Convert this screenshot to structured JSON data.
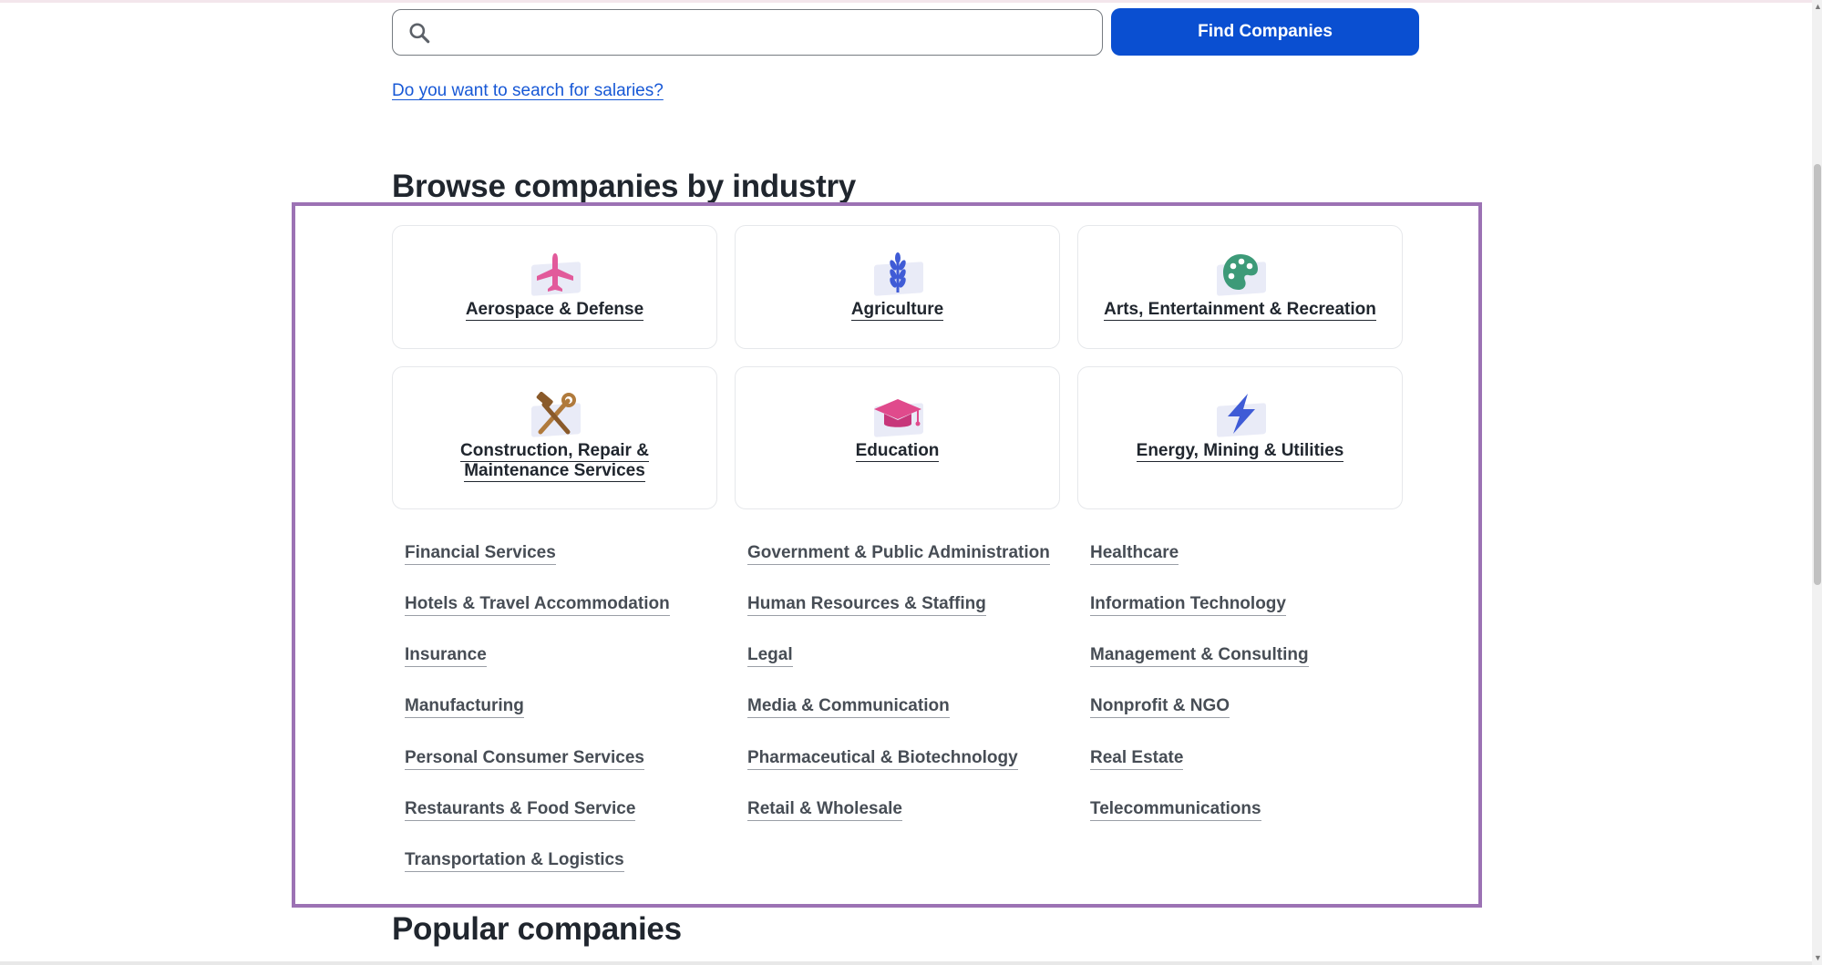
{
  "search": {
    "value": "",
    "icon": "search-icon",
    "button_label": "Find Companies"
  },
  "salary_link": "Do you want to search for salaries?",
  "browse": {
    "title": "Browse companies by industry",
    "featured": [
      {
        "label": "Aerospace & Defense",
        "icon": "airplane-icon",
        "color": "#e25a9b"
      },
      {
        "label": "Agriculture",
        "icon": "wheat-icon",
        "color": "#3f5bd6"
      },
      {
        "label": "Arts, Entertainment & Recreation",
        "icon": "palette-icon",
        "color": "#3d9a78"
      },
      {
        "label": "Construction, Repair & Maintenance Services",
        "icon": "tools-icon",
        "color": "#b07a3c"
      },
      {
        "label": "Education",
        "icon": "graduation-cap-icon",
        "color": "#e04a8c"
      },
      {
        "label": "Energy, Mining & Utilities",
        "icon": "lightning-icon",
        "color": "#3f5bd6"
      }
    ],
    "industries": [
      "Financial Services",
      "Government & Public Administration",
      "Healthcare",
      "Hotels & Travel Accommodation",
      "Human Resources & Staffing",
      "Information Technology",
      "Insurance",
      "Legal",
      "Management & Consulting",
      "Manufacturing",
      "Media & Communication",
      "Nonprofit & NGO",
      "Personal Consumer Services",
      "Pharmaceutical & Biotechnology",
      "Real Estate",
      "Restaurants & Food Service",
      "Retail & Wholesale",
      "Telecommunications",
      "Transportation & Logistics"
    ]
  },
  "popular": {
    "title": "Popular companies"
  },
  "colors": {
    "primary_button": "#0a4fd1",
    "link": "#1758d6",
    "highlight_frame": "#9c72b4",
    "heading": "#20262e"
  }
}
